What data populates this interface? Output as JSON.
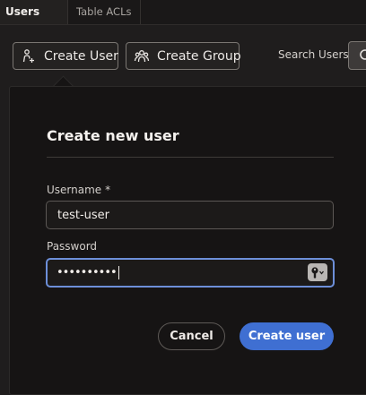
{
  "tabs": [
    {
      "label": "Users",
      "active": true
    },
    {
      "label": "Table ACLs",
      "active": false
    }
  ],
  "toolbar": {
    "create_user": {
      "label": "Create User",
      "icon": "add-user-icon"
    },
    "create_group": {
      "label": "Create Group",
      "icon": "group-icon"
    },
    "search_label": "Search Users",
    "search_icon": "search-icon"
  },
  "dialog": {
    "title": "Create new user",
    "username": {
      "label": "Username",
      "required_mark": "*",
      "value": "test-user"
    },
    "password": {
      "label": "Password",
      "masked_value": "••••••••••",
      "reveal_icon": "key-icon"
    },
    "cancel_label": "Cancel",
    "submit_label": "Create user"
  },
  "colors": {
    "accent": "#3f6fd2",
    "focus_border": "#6d8fd9",
    "background": "#1f1d1d",
    "dialog_background": "#161414"
  }
}
